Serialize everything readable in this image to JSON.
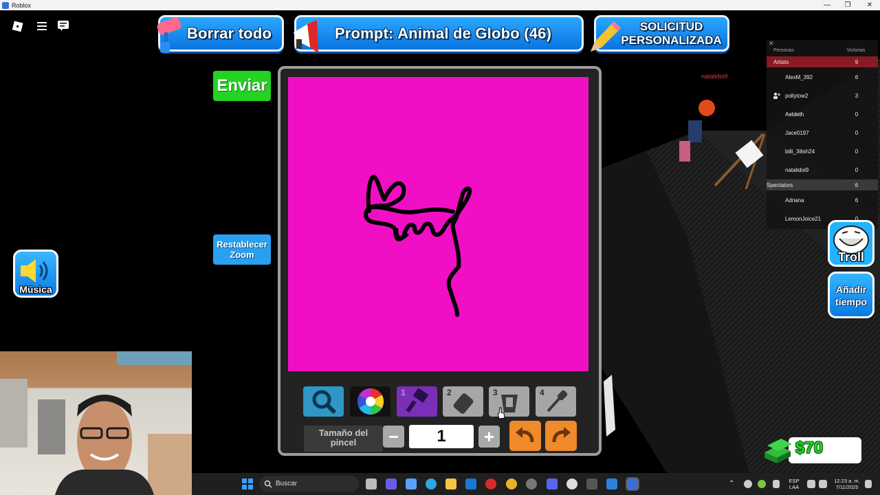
{
  "window": {
    "title": "Roblox"
  },
  "top_buttons": {
    "clear": "Borrar todo",
    "prompt": "Prompt: Animal de Globo (46)",
    "custom_line1": "SOLICITUD",
    "custom_line2": "PERSONALIZADA"
  },
  "left_buttons": {
    "send": "Enviar",
    "reset_zoom_line1": "Restablecer",
    "reset_zoom_line2": "Zoom",
    "music": "Música"
  },
  "toolbar": {
    "brush_num": "1",
    "eraser_num": "2",
    "fill_num": "3",
    "picker_num": "4",
    "size_label_line1": "Tamaño del",
    "size_label_line2": "pincel",
    "minus": "−",
    "plus": "+",
    "size_value": "1"
  },
  "leaderboard": {
    "col_people": "Personas",
    "col_wins": "Victorias",
    "teams": [
      {
        "name": "Artists",
        "score": "9"
      },
      {
        "name": "Spectators",
        "score": "6"
      }
    ],
    "players": [
      {
        "name": "AlexM_392",
        "score": "6"
      },
      {
        "name": "pollytow2",
        "score": "3"
      },
      {
        "name": "Aeldeth",
        "score": "0"
      },
      {
        "name": "Jace0197",
        "score": "0"
      },
      {
        "name": "billi_3ilish24",
        "score": "0"
      },
      {
        "name": "natalidoi9",
        "score": "0"
      },
      {
        "name": "Adriana",
        "score": "6"
      },
      {
        "name": "LemonJoice21",
        "score": "0"
      }
    ]
  },
  "scene": {
    "player_tag": "natalidoi9"
  },
  "right_buttons": {
    "troll": "Troll",
    "add_time_line1": "Añadir",
    "add_time_line2": "tiempo",
    "money": "$70"
  },
  "taskbar": {
    "search": "Buscar",
    "lang_line1": "ESP",
    "lang_line2": "LAA",
    "time": "12:23 a. m.",
    "date": "7/11/2025"
  },
  "colors": {
    "canvas": "#f10fc6",
    "send_green": "#22d421",
    "hud_blue": "#0a74e0"
  }
}
